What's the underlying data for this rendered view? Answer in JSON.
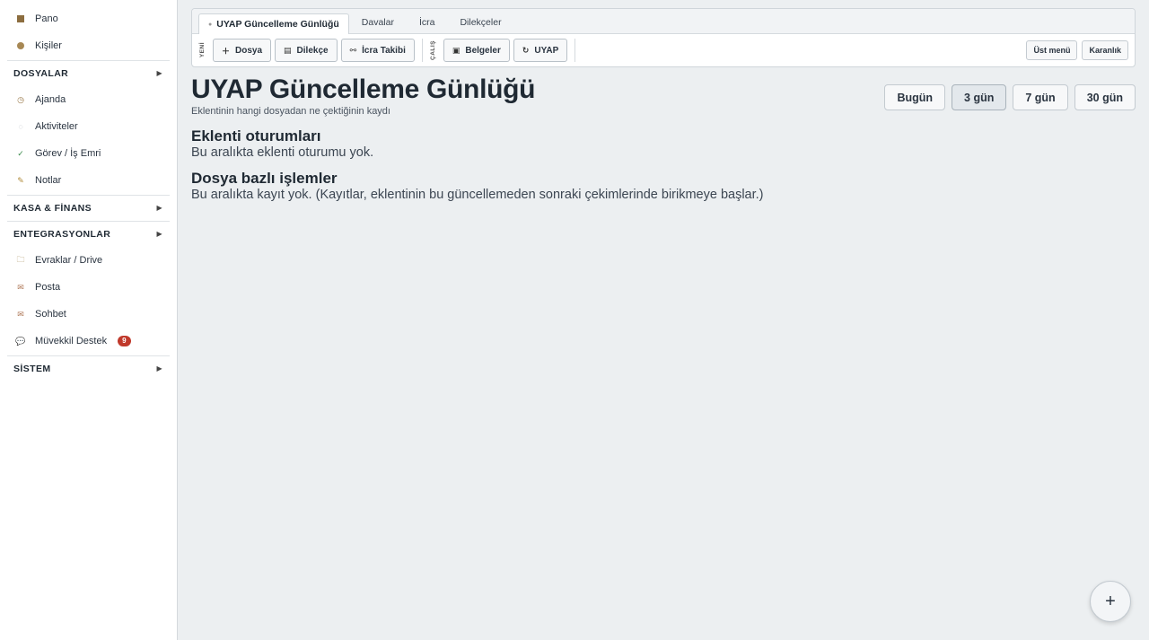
{
  "sidebar": {
    "items_top": [
      {
        "label": "Pano",
        "icon": "dashboard-icon"
      },
      {
        "label": "Kişiler",
        "icon": "people-icon"
      }
    ],
    "section_dosyalar": "DOSYALAR",
    "items_mid": [
      {
        "label": "Ajanda",
        "icon": "clock-icon"
      },
      {
        "label": "Aktiviteler",
        "icon": "activity-icon"
      },
      {
        "label": "Görev / İş Emri",
        "icon": "check-icon"
      },
      {
        "label": "Notlar",
        "icon": "pencil-icon"
      }
    ],
    "section_kasa": "KASA & FİNANS",
    "section_entegrasyon": "ENTEGRASYONLAR",
    "items_int": [
      {
        "label": "Evraklar / Drive",
        "icon": "folder-icon"
      },
      {
        "label": "Posta",
        "icon": "mail-icon"
      },
      {
        "label": "Sohbet",
        "icon": "chat-icon"
      },
      {
        "label": "Müvekkil Destek",
        "icon": "support-icon",
        "badge": "9"
      }
    ],
    "section_sistem": "SİSTEM"
  },
  "tabs": [
    "UYAP Güncelleme Günlüğü",
    "Davalar",
    "İcra",
    "Dilekçeler"
  ],
  "toolbar": {
    "group1_label": "YENİ",
    "dosya": "Dosya",
    "dilekce": "Dilekçe",
    "icra_takibi": "İcra Takibi",
    "group2_label": "ÇALIŞ",
    "belgeler": "Belgeler",
    "uyap": "UYAP",
    "ust_menu": "Üst menü",
    "karanlik": "Karanlık"
  },
  "page": {
    "title": "UYAP Güncelleme Günlüğü",
    "subtitle": "Eklentinin hangi dosyadan ne çektiğinin kaydı"
  },
  "range": {
    "options": [
      "Bugün",
      "3 gün",
      "7 gün",
      "30 gün"
    ],
    "selected": "3 gün"
  },
  "sessions": {
    "title": "Eklenti oturumları",
    "empty": "Bu aralıkta eklenti oturumu yok."
  },
  "operations": {
    "title": "Dosya bazlı işlemler",
    "empty": "Bu aralıkta kayıt yok. (Kayıtlar, eklentinin bu güncellemeden sonraki çekimlerinde birikmeye başlar.)"
  },
  "fab_icon": "plus-icon"
}
